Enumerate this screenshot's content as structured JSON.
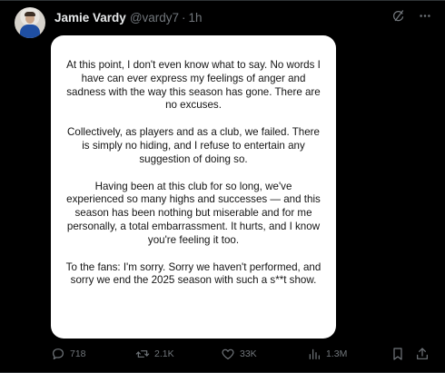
{
  "post": {
    "author_name": "Jamie Vardy",
    "author_handle": "@vardy7",
    "separator": "·",
    "time": "1h",
    "icons": {
      "avatar": "profile-photo",
      "grok": "grok-icon",
      "more": "more-icon"
    },
    "image_text": [
      "At this point, I don't even know what to say. No words I have can ever express my feelings of anger and sadness with the way this season has gone. There are no excuses.",
      "Collectively, as players and as a club, we failed. There is simply no hiding, and I refuse to entertain any suggestion of doing so.",
      "Having been at this club for so long, we've experienced so many highs and successes — and this season has been nothing but miserable and for me personally, a total embarrassment. It hurts, and I know you're feeling it too.",
      "To the fans: I'm sorry. Sorry we haven't performed, and sorry we end the 2025 season with such a s**t show."
    ],
    "stats": {
      "replies": "718",
      "reposts": "2.1K",
      "likes": "33K",
      "views": "1.3M"
    },
    "action_icons": [
      "reply-icon",
      "repost-icon",
      "like-icon",
      "views-icon",
      "bookmark-icon",
      "share-icon"
    ]
  },
  "colors": {
    "background": "#000000",
    "text_primary": "#e7e9ea",
    "text_secondary": "#71767b",
    "card_background": "#ffffff",
    "card_text": "#141414"
  }
}
